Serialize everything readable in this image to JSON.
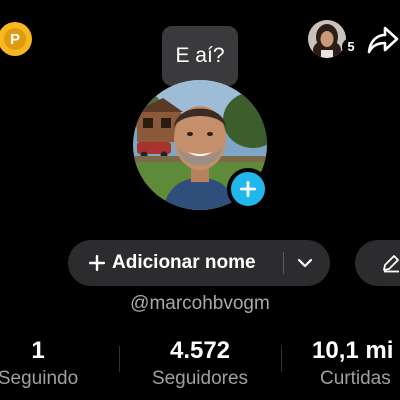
{
  "bubble": {
    "text": "E aí?"
  },
  "coin": {
    "letter": "P"
  },
  "friends": {
    "count": "5"
  },
  "profile": {
    "add_name_label": "Adicionar nome",
    "username": "@marcohbvogm"
  },
  "stats": [
    {
      "value": "1",
      "label": "Seguindo"
    },
    {
      "value": "4.572",
      "label": "Seguidores"
    },
    {
      "value": "10,1 mi",
      "label": "Curtidas"
    }
  ],
  "colors": {
    "background": "#000000",
    "pill": "#2c2c2e",
    "accent_blue": "#20b7ea",
    "coin_gold": "#f5b820",
    "muted_text": "#9e9ea3"
  },
  "icons": {
    "coin": "coin-p-icon",
    "share": "share-arrow-icon",
    "add_avatar": "plus-circle-icon",
    "add_name": "plus-icon",
    "dropdown": "chevron-down-icon",
    "edit": "pencil-icon"
  }
}
